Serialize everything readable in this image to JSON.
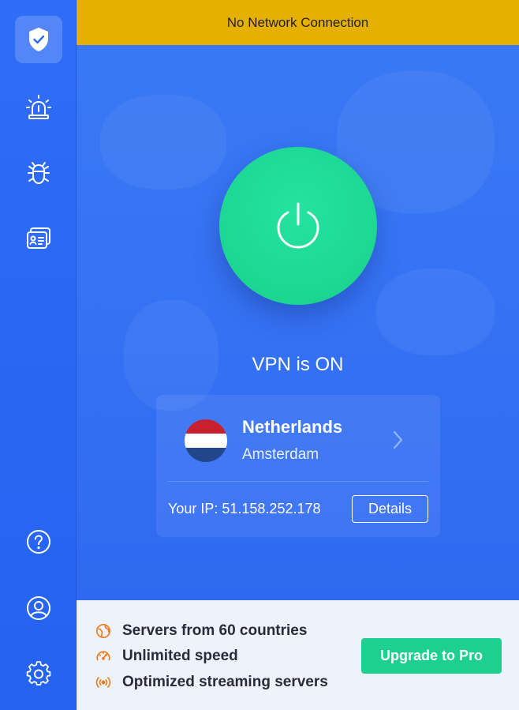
{
  "banner": {
    "text": "No Network Connection"
  },
  "sidebar": {
    "items": [
      {
        "name": "protection",
        "icon": "shield-check-icon",
        "active": true
      },
      {
        "name": "alerts",
        "icon": "siren-icon"
      },
      {
        "name": "malware",
        "icon": "bug-icon"
      },
      {
        "name": "id-card",
        "icon": "id-card-icon"
      },
      {
        "name": "help",
        "icon": "help-icon"
      },
      {
        "name": "account",
        "icon": "account-icon"
      },
      {
        "name": "settings",
        "icon": "gear-icon"
      }
    ]
  },
  "vpn": {
    "status": "VPN is ON",
    "location": {
      "country": "Netherlands",
      "city": "Amsterdam"
    },
    "ip_label": "Your IP: 51.158.252.178",
    "details_label": "Details"
  },
  "promo": {
    "features": [
      {
        "text": "Servers from 60 countries",
        "icon": "globe-icon"
      },
      {
        "text": "Unlimited speed",
        "icon": "speedometer-icon"
      },
      {
        "text": "Optimized streaming servers",
        "icon": "broadcast-icon"
      }
    ],
    "upgrade_label": "Upgrade to Pro"
  },
  "colors": {
    "sidebar": "#2f6df6",
    "main": "#3674f4",
    "banner": "#e5b000",
    "power": "#1ed894",
    "accent_orange": "#f07a1a",
    "upgrade": "#1dd090"
  }
}
